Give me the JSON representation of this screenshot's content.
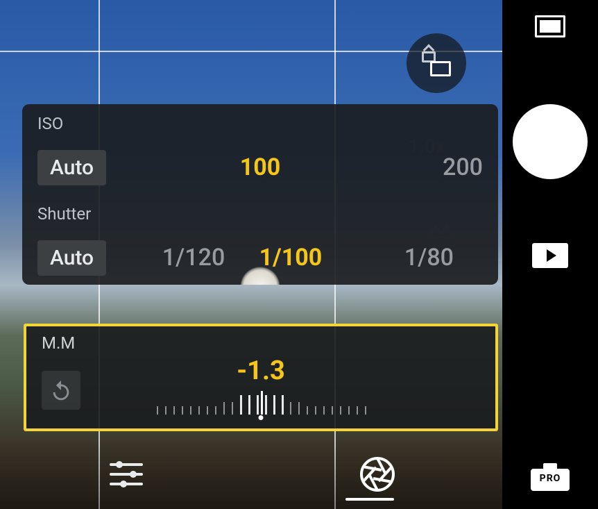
{
  "viewfinder": {
    "zoom_label": "1.0x"
  },
  "panel": {
    "iso": {
      "label": "ISO",
      "auto_label": "Auto",
      "selected": "100",
      "next": "200"
    },
    "shutter": {
      "label": "Shutter",
      "auto_label": "Auto",
      "prev": "1/120",
      "selected": "1/100",
      "next": "1/80"
    }
  },
  "mm": {
    "label": "M.M",
    "value": "-1.3"
  },
  "sidebar": {
    "pro_label": "PRO"
  },
  "icons": {
    "aspect_ratio": "aspect-ratio-icon",
    "pip": "pip-switch-icon",
    "peaks": "histogram-peak-icon",
    "shutter": "shutter-button",
    "playback": "playback-button",
    "pro": "pro-mode-button",
    "reset": "reset-icon",
    "sliders": "adjust-sliders-icon",
    "aperture": "aperture-icon"
  }
}
